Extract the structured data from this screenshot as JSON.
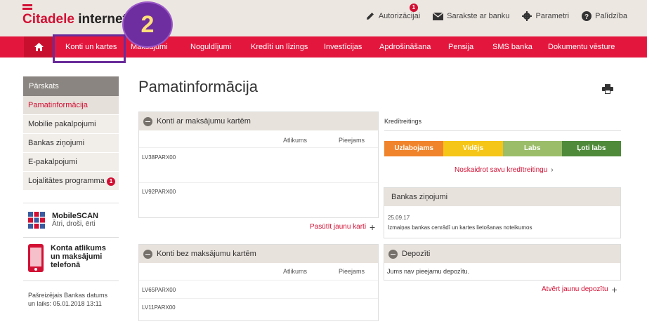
{
  "header": {
    "logo_red": "Citadele",
    "logo_dark": "internetba",
    "actions": [
      {
        "label": "Autorizācijai",
        "icon": "pencil-icon",
        "badge": "1"
      },
      {
        "label": "Sarakste ar banku",
        "icon": "envelope-icon"
      },
      {
        "label": "Parametri",
        "icon": "gear-icon"
      },
      {
        "label": "Palīdzība",
        "icon": "help-icon"
      }
    ]
  },
  "nav": {
    "items": [
      "Konti un kartes",
      "Maksājumi",
      "Noguldījumi",
      "Kredīti un līzings",
      "Investīcijas",
      "Apdrošināšana",
      "Pensija",
      "SMS banka",
      "Dokumentu vēsture"
    ]
  },
  "annotation": {
    "step": "2"
  },
  "sidebar": {
    "heading": "Pārskats",
    "items": [
      "Pamatinformācija",
      "Mobilie pakalpojumi",
      "Bankas ziņojumi",
      "E-pakalpojumi",
      "Lojalitātes programma"
    ],
    "loyalty_badge": "1",
    "mobilescan": {
      "title": "MobileSCAN",
      "subtitle": "Ātri, droši, ērti"
    },
    "phone_promo": {
      "line1": "Konta atlikums",
      "line2": "un maksājumi",
      "line3": "telefonā"
    },
    "bank_date": {
      "line1": "Pašreizējais Bankas datums",
      "line2": "un laiks: 05.01.2018 13:11"
    }
  },
  "main": {
    "title": "Pamatinformācija",
    "cards_panel": {
      "title": "Konti ar maksājumu kartēm",
      "col_balance": "Atlikums",
      "col_available": "Pieejams",
      "accounts": [
        "LV38PARX00",
        "LV92PARX00"
      ],
      "link": "Pasūtīt jaunu karti"
    },
    "nocards_panel": {
      "title": "Konti bez maksājumu kartēm",
      "col_balance": "Atlikums",
      "col_available": "Pieejams",
      "accounts": [
        "LV65PARX00",
        "LV11PARX00"
      ]
    },
    "credit_rating": {
      "label": "Kredītreitings",
      "segments": [
        {
          "label": "Uzlabojams",
          "color": "#f0842c"
        },
        {
          "label": "Vidējs",
          "color": "#f5c518"
        },
        {
          "label": "Labs",
          "color": "#9bbd6a"
        },
        {
          "label": "Ļoti labs",
          "color": "#4f8a3a"
        }
      ],
      "link": "Noskaidrot savu kredītreitingu"
    },
    "bank_news": {
      "title": "Bankas ziņojumi",
      "date": "25.09.17",
      "text": "Izmaiņas bankas cenrādī un kartes lietošanas noteikumos"
    },
    "deposits": {
      "title": "Depozīti",
      "text": "Jums nav pieejamu depozītu.",
      "link": "Atvērt jaunu depozītu"
    }
  }
}
